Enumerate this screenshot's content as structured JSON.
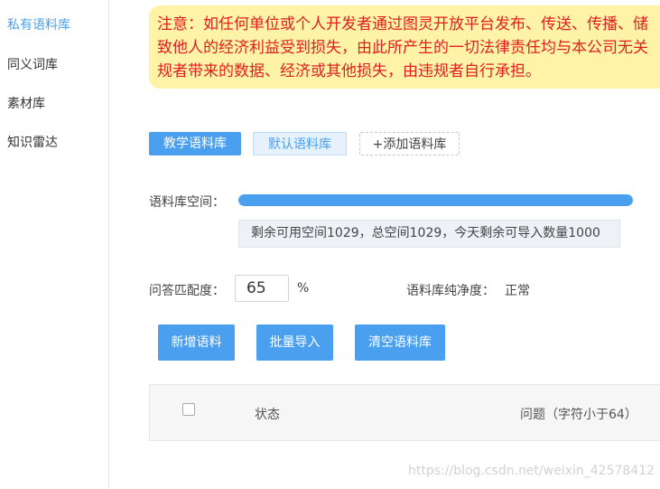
{
  "sidebar": {
    "items": [
      {
        "label": "私有语料库",
        "active": true
      },
      {
        "label": "同义词库",
        "active": false
      },
      {
        "label": "素材库",
        "active": false
      },
      {
        "label": "知识雷达",
        "active": false
      }
    ]
  },
  "notice": {
    "line1": "注意：如任何单位或个人开发者通过图灵开放平台发布、传送、传播、储",
    "line2": "致他人的经济利益受到损失，由此所产生的一切法律责任均与本公司无关",
    "line3": "规者带来的数据、经济或其他损失，由违规者自行承担。"
  },
  "corpus_tabs": {
    "tab1": "教学语料库",
    "tab2": "默认语料库",
    "add": "+添加语料库"
  },
  "space": {
    "label": "语料库空间：",
    "used_fraction": 1.0,
    "info": "剩余可用空间1029，总空间1029，今天剩余可导入数量1000"
  },
  "match": {
    "label": "问答匹配度：",
    "value": "65",
    "unit": "%"
  },
  "purity": {
    "label": "语料库纯净度：",
    "value": "正常"
  },
  "actions": {
    "add": "新增语料",
    "import": "批量导入",
    "clear": "清空语料库"
  },
  "table": {
    "col_status": "状态",
    "col_question": "问题（字符小于64）"
  },
  "watermark": "https://blog.csdn.net/weixin_42578412",
  "colors": {
    "accent": "#4aa0ef",
    "notice_bg": "#fff3a8",
    "notice_text": "#e0201f"
  }
}
